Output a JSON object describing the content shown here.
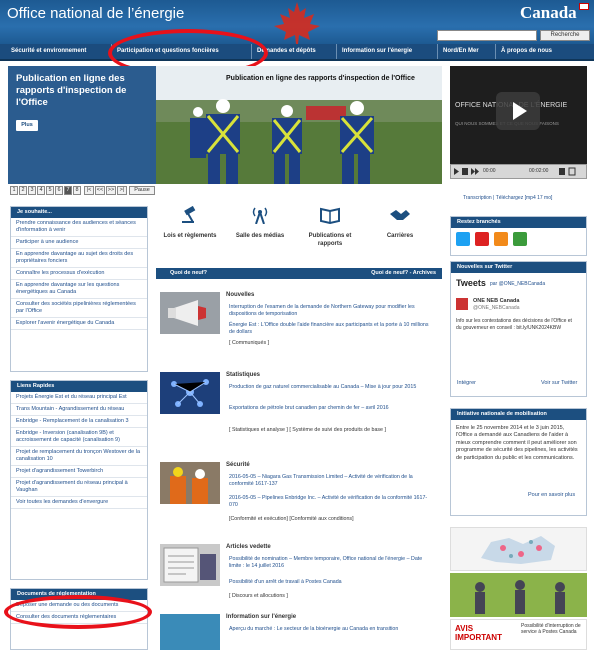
{
  "header": {
    "title": "Office national de l’énergie",
    "wordmark": "Canada",
    "search_button": "Recherche"
  },
  "nav": [
    "Sécurité et environnement",
    "Participation et questions foncières",
    "Demandes et dépôts",
    "Information sur l'énergie",
    "Nord/En Mer",
    "À propos de nous"
  ],
  "feature": {
    "title": "Publication en ligne des rapports d'inspection de l'Office",
    "more_button": "Plus",
    "image_caption": "Publication en ligne des rapports d'inspection de l'Office"
  },
  "pager": {
    "pages": [
      "1",
      "2",
      "3",
      "4",
      "5",
      "6",
      "7",
      "8"
    ],
    "controls": [
      "|<",
      "<<",
      ">>",
      ">|"
    ],
    "pause": "Pause"
  },
  "video": {
    "title": "OFFICE NATIONAL DE L'ÉNERGIE",
    "subtitle": "QUI NOUS SOMMES ET CE QUE NOUS FAISONS",
    "time": "00:00",
    "duration": "00:02:00",
    "links": "Transcription | Téléchargez [mp4 17 mo]"
  },
  "sidebar_souhaite": {
    "heading": "Je souhaite...",
    "items": [
      "Prendre connaissance des audiences et séances d'information à venir",
      "Participer à une audience",
      "En apprendre davantage au sujet des droits des propriétaires fonciers",
      "Connaître les processus d'exécution",
      "En apprendre davantage sur les questions énergétiques au Canada",
      "Consulter des sociétés pipelinières réglementées par l'Office",
      "Explorer l'avenir énergétique du Canada"
    ]
  },
  "sidebar_liens": {
    "heading": "Liens Rapides",
    "items": [
      "Projets Énergie Est et du réseau principal Est",
      "Trans Mountain - Agrandissement du réseau",
      "Enbridge - Remplacement de la canalisation 3",
      "Enbridge - Inversion (canalisation 9B) et accroissement de capacité (canalisation 9)",
      "Projet de remplacement du tronçon Westover de la canalisation 10",
      "Projet d'agrandissement Towerbirch",
      "Projet d'agrandissement du réseau principal à Vaughan",
      "Voir toutes les demandes d'envergure"
    ]
  },
  "sidebar_docs": {
    "heading": "Documents de réglementation",
    "items": [
      "Déposer une demande ou des documents",
      "Consulter des documents réglementaires"
    ]
  },
  "icons": [
    "Lois et règlements",
    "Salle des médias",
    "Publications et rapports",
    "Carrières"
  ],
  "news_bar": {
    "left": "Quoi de neuf?",
    "right": "Quoi de neuf? - Archives"
  },
  "news": [
    {
      "heading": "Nouvelles",
      "links": [
        "Interruption de l'examen de la demande de Northern Gateway pour modifier les dispositions de temporisation",
        "Énergie Est : L'Office double l'aide financière aux participants et la porte à 10 millions de dollars"
      ],
      "footer": "[ Communiqués ]"
    },
    {
      "heading": "Statistiques",
      "links": [
        "Production de gaz naturel commercialisable au Canada – Mise à jour pour 2015",
        "Exportations de pétrole brut canadien par chemin de fer – avril 2016"
      ],
      "footer": "[ Statistiques et analyse ] [ Système de suivi des produits de base ]"
    },
    {
      "heading": "Sécurité",
      "links": [
        "2016-05-05 – Niagara Gas Transmission Limited – Activité de vérification de la conformité 1617-137",
        "2016-05-05 – Pipelines Enbridge Inc. – Activité de vérification de la conformité 1617-070"
      ],
      "footer": "[Conformité et exécution] [Conformité aux conditions]"
    },
    {
      "heading": "Articles vedette",
      "links": [
        "Possibilité de nomination – Membre temporaire, Office national de l'énergie – Date limite : le 14 juillet 2016",
        "Possibilité d'un arrêt de travail à Postes Canada"
      ],
      "footer": "[ Discours et allocutions ]"
    },
    {
      "heading": "Information sur l'énergie",
      "links": [
        "Aperçu du marché : Le secteur de la bioénergie au Canada en transition"
      ],
      "footer": ""
    }
  ],
  "social": {
    "heading": "Restez branchés"
  },
  "twitter": {
    "heading": "Nouvelles sur Twitter",
    "tweets_label": "Tweets",
    "handle": "par @ONE_NEBCanada",
    "account": "ONE NEB Canada",
    "account_handle": "@ONE_NEBCanada",
    "tweet": "Info sur les contestations des décisions de l'Office et du gouverneur en conseil : bit.ly/UNK2024KBW",
    "embed": "Intégrer",
    "view": "Voir sur Twitter"
  },
  "mobilisation": {
    "heading": "Initiative nationale de mobilisation",
    "text": "Entre le 25 novembre 2014 et le 3 juin 2015, l'Office a demandé aux Canadiens de l'aider à mieux comprendre comment il peut améliorer son programme de sécurité des pipelines, les activités de participation du public et les communications.",
    "link": "Pour en savoir plus"
  },
  "promo": {
    "avis": "AVIS IMPORTANT",
    "avis_text": "Possibilité d'interruption de service à Postes Canada"
  },
  "colors": {
    "nav": "#1b4c7e",
    "header": "#2a6fae",
    "highlight": "#e8111a"
  }
}
